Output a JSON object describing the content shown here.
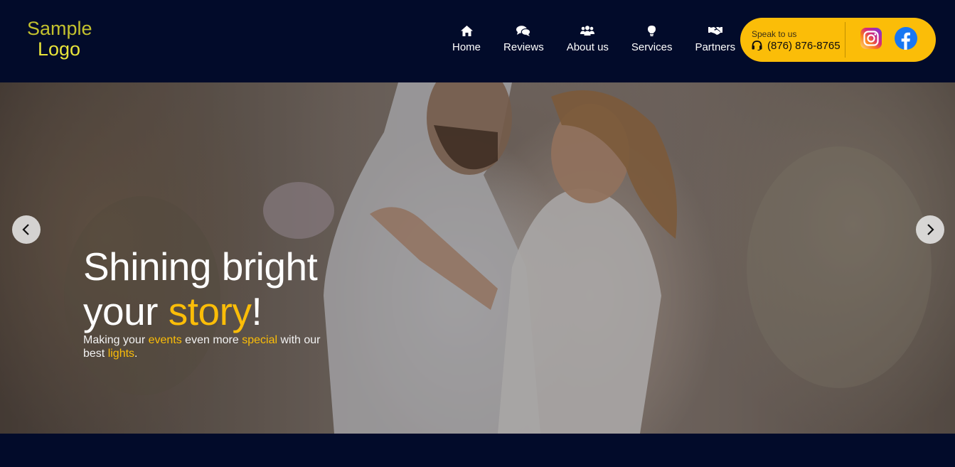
{
  "logo": {
    "line1": "Sample",
    "line2": "Logo"
  },
  "nav": [
    {
      "label": "Home",
      "icon": "home-icon"
    },
    {
      "label": "Reviews",
      "icon": "comments-icon"
    },
    {
      "label": "About us",
      "icon": "users-icon"
    },
    {
      "label": "Services",
      "icon": "lightbulb-icon"
    },
    {
      "label": "Partners",
      "icon": "handshake-icon"
    }
  ],
  "contact": {
    "speak_label": "Speak to us",
    "phone": "(876) 876-8765",
    "phone_icon": "headset-icon",
    "social": [
      "instagram-icon",
      "facebook-icon"
    ]
  },
  "hero": {
    "headline_part1": "Shining bright",
    "headline_part2": "your ",
    "headline_accent": "story",
    "headline_end": "!",
    "sub_part1": "Making your ",
    "sub_accent1": "events",
    "sub_part2": " even more ",
    "sub_accent2": "special",
    "sub_part3": " with our best ",
    "sub_accent3": "lights",
    "sub_end": ".",
    "prev_icon": "chevron-left-icon",
    "next_icon": "chevron-right-icon"
  },
  "colors": {
    "header_bg": "#020b2a",
    "accent": "#fbbd08",
    "logo_text": "#e8e43a"
  }
}
